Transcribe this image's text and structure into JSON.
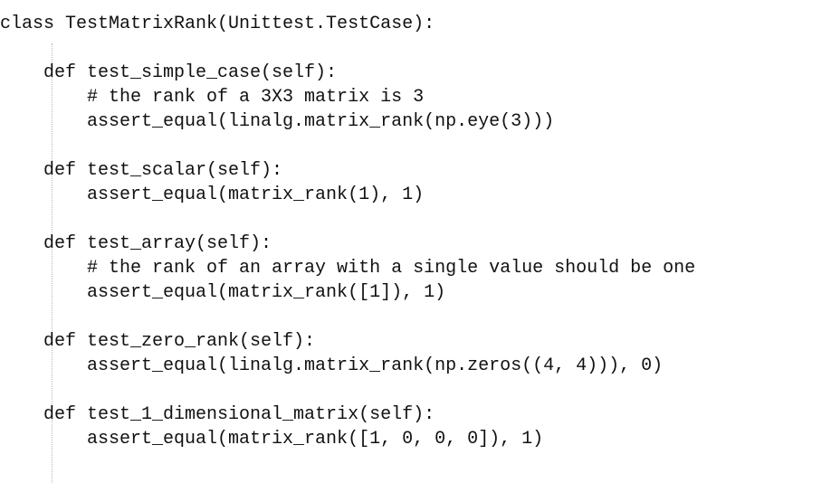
{
  "editor": {
    "lines": [
      "class TestMatrixRank(Unittest.TestCase):",
      "",
      "    def test_simple_case(self):",
      "        # the rank of a 3X3 matrix is 3",
      "        assert_equal(linalg.matrix_rank(np.eye(3)))",
      "",
      "    def test_scalar(self):",
      "        assert_equal(matrix_rank(1), 1)",
      "",
      "    def test_array(self):",
      "        # the rank of an array with a single value should be one",
      "        assert_equal(matrix_rank([1]), 1)",
      "",
      "    def test_zero_rank(self):",
      "        assert_equal(linalg.matrix_rank(np.zeros((4, 4))), 0)",
      "",
      "    def test_1_dimensional_matrix(self):",
      "        assert_equal(matrix_rank([1, 0, 0, 0]), 1)"
    ]
  },
  "colors": {
    "background": "#ffffff",
    "text": "#111111",
    "indent_guide": "#b8b8b8"
  }
}
